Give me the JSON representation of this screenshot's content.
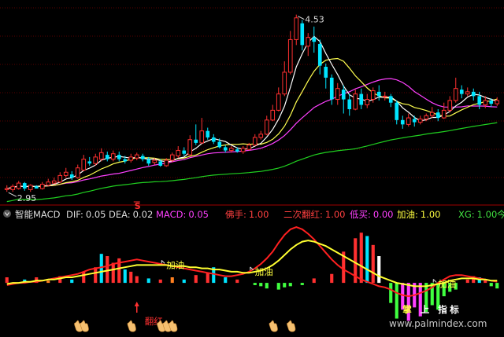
{
  "chart_data": [
    {
      "type": "candlestick",
      "panel": "main",
      "ylim": [
        2.8,
        4.65
      ],
      "annotations": {
        "high_label": "4.53",
        "low_label": "2.95",
        "marker": "S"
      },
      "colors": {
        "up": "#ff3030",
        "down": "#00e5ff",
        "ma_short": "#ffffff",
        "ma_mid": "#ffff50",
        "ma_long": "#ff40ff",
        "ma_longest": "#20d020"
      },
      "candles": [
        [
          2.92,
          2.93,
          2.96,
          2.9
        ],
        [
          2.92,
          2.95,
          2.97,
          2.9
        ],
        [
          2.93,
          2.98,
          3.0,
          2.92
        ],
        [
          2.98,
          2.93,
          2.99,
          2.91
        ],
        [
          2.92,
          2.96,
          2.97,
          2.9
        ],
        [
          2.95,
          2.93,
          2.96,
          2.95
        ],
        [
          2.93,
          2.97,
          2.99,
          2.92
        ],
        [
          2.96,
          2.99,
          3.02,
          2.95
        ],
        [
          2.98,
          3.0,
          3.03,
          2.97
        ],
        [
          2.99,
          3.05,
          3.08,
          2.98
        ],
        [
          3.05,
          3.08,
          3.12,
          3.03
        ],
        [
          3.06,
          3.03,
          3.09,
          3.01
        ],
        [
          3.03,
          3.12,
          3.15,
          3.02
        ],
        [
          3.1,
          3.2,
          3.24,
          3.09
        ],
        [
          3.18,
          3.16,
          3.22,
          3.14
        ],
        [
          3.16,
          3.22,
          3.25,
          3.14
        ],
        [
          3.2,
          3.26,
          3.3,
          3.18
        ],
        [
          3.24,
          3.2,
          3.27,
          3.18
        ],
        [
          3.2,
          3.25,
          3.28,
          3.18
        ],
        [
          3.24,
          3.2,
          3.27,
          3.18
        ],
        [
          3.2,
          3.18,
          3.23,
          3.16
        ],
        [
          3.19,
          3.22,
          3.25,
          3.17
        ],
        [
          3.21,
          3.24,
          3.26,
          3.19
        ],
        [
          3.23,
          3.2,
          3.25,
          3.18
        ],
        [
          3.2,
          3.16,
          3.22,
          3.14
        ],
        [
          3.17,
          3.19,
          3.21,
          3.15
        ],
        [
          3.18,
          3.14,
          3.2,
          3.13
        ],
        [
          3.14,
          3.19,
          3.21,
          3.13
        ],
        [
          3.19,
          3.24,
          3.26,
          3.17
        ],
        [
          3.23,
          3.28,
          3.32,
          3.21
        ],
        [
          3.28,
          3.25,
          3.31,
          3.23
        ],
        [
          3.24,
          3.38,
          3.42,
          3.23
        ],
        [
          3.38,
          3.35,
          3.52,
          3.33
        ],
        [
          3.35,
          3.46,
          3.58,
          3.34
        ],
        [
          3.46,
          3.4,
          3.49,
          3.38
        ],
        [
          3.4,
          3.36,
          3.43,
          3.34
        ],
        [
          3.36,
          3.31,
          3.39,
          3.3
        ],
        [
          3.31,
          3.28,
          3.33,
          3.26
        ],
        [
          3.28,
          3.3,
          3.32,
          3.26
        ],
        [
          3.29,
          3.27,
          3.31,
          3.26
        ],
        [
          3.27,
          3.3,
          3.32,
          3.25
        ],
        [
          3.29,
          3.33,
          3.35,
          3.28
        ],
        [
          3.33,
          3.4,
          3.43,
          3.32
        ],
        [
          3.4,
          3.43,
          3.46,
          3.38
        ],
        [
          3.43,
          3.56,
          3.6,
          3.42
        ],
        [
          3.56,
          3.65,
          3.7,
          3.55
        ],
        [
          3.65,
          3.8,
          3.86,
          3.64
        ],
        [
          3.8,
          4.0,
          4.1,
          3.78
        ],
        [
          4.0,
          4.3,
          4.38,
          3.98
        ],
        [
          4.3,
          4.5,
          4.53,
          4.25
        ],
        [
          4.45,
          4.25,
          4.48,
          4.2
        ],
        [
          4.24,
          4.32,
          4.36,
          4.15
        ],
        [
          4.32,
          4.28,
          4.42,
          4.18
        ],
        [
          4.26,
          4.06,
          4.3,
          3.98
        ],
        [
          4.05,
          3.95,
          4.08,
          3.85
        ],
        [
          3.95,
          3.75,
          3.98,
          3.7
        ],
        [
          3.75,
          3.85,
          3.9,
          3.7
        ],
        [
          3.84,
          3.75,
          3.88,
          3.62
        ],
        [
          3.75,
          3.66,
          3.8,
          3.6
        ],
        [
          3.66,
          3.8,
          3.84,
          3.65
        ],
        [
          3.8,
          3.7,
          3.85,
          3.66
        ],
        [
          3.7,
          3.75,
          3.8,
          3.67
        ],
        [
          3.75,
          3.83,
          3.86,
          3.72
        ],
        [
          3.82,
          3.78,
          3.88,
          3.74
        ],
        [
          3.78,
          3.78,
          3.82,
          3.74
        ],
        [
          3.78,
          3.72,
          3.8,
          3.68
        ],
        [
          3.72,
          3.56,
          3.74,
          3.52
        ],
        [
          3.56,
          3.52,
          3.6,
          3.48
        ],
        [
          3.52,
          3.58,
          3.62,
          3.5
        ],
        [
          3.57,
          3.54,
          3.6,
          3.5
        ],
        [
          3.54,
          3.57,
          3.6,
          3.52
        ],
        [
          3.57,
          3.6,
          3.62,
          3.55
        ],
        [
          3.6,
          3.63,
          3.68,
          3.58
        ],
        [
          3.63,
          3.58,
          3.66,
          3.55
        ],
        [
          3.58,
          3.65,
          3.72,
          3.57
        ],
        [
          3.65,
          3.74,
          3.78,
          3.63
        ],
        [
          3.74,
          3.85,
          3.95,
          3.72
        ],
        [
          3.84,
          3.8,
          3.88,
          3.76
        ],
        [
          3.8,
          3.82,
          3.86,
          3.78
        ],
        [
          3.82,
          3.78,
          3.85,
          3.74
        ],
        [
          3.78,
          3.7,
          3.82,
          3.66
        ],
        [
          3.7,
          3.74,
          3.78,
          3.67
        ],
        [
          3.74,
          3.71,
          3.76,
          3.68
        ],
        [
          3.71,
          3.74,
          3.77,
          3.69
        ]
      ]
    },
    {
      "type": "bar",
      "panel": "indicator",
      "indicator_title": "智能MACD",
      "legend": [
        {
          "label": "DIF:",
          "value": "0.05",
          "color": "#ffffff"
        },
        {
          "label": "DEA:",
          "value": "0.02",
          "color": "#ffff40"
        },
        {
          "label": "MACD:",
          "value": "0.05",
          "color": "#ff40ff"
        },
        {
          "label": "佛手:",
          "value": "1.00",
          "color": "#ff4040"
        },
        {
          "label": "二次翻红:",
          "value": "1.00",
          "color": "#ff4040"
        },
        {
          "label": "低买:",
          "value": "0.00",
          "color": "#ff40ff"
        },
        {
          "label": "加油:",
          "value": "1.00",
          "color": "#ffff40"
        },
        {
          "label": "XG:",
          "value": "1.00",
          "color": "#40e040"
        },
        {
          "label": "今",
          "value": "",
          "color": "#40e040"
        }
      ],
      "ylim": [
        -0.45,
        0.55
      ],
      "zero_line": 0,
      "series_dif": [
        -0.02,
        -0.01,
        0.0,
        0.0,
        0.01,
        0.01,
        0.02,
        0.03,
        0.04,
        0.05,
        0.06,
        0.07,
        0.08,
        0.1,
        0.12,
        0.13,
        0.14,
        0.15,
        0.17,
        0.18,
        0.19,
        0.2,
        0.21,
        0.2,
        0.19,
        0.18,
        0.17,
        0.16,
        0.15,
        0.14,
        0.13,
        0.12,
        0.11,
        0.1,
        0.09,
        0.08,
        0.07,
        0.06,
        0.06,
        0.07,
        0.08,
        0.1,
        0.13,
        0.17,
        0.22,
        0.28,
        0.36,
        0.43,
        0.48,
        0.5,
        0.48,
        0.44,
        0.39,
        0.33,
        0.27,
        0.21,
        0.16,
        0.12,
        0.09,
        0.06,
        0.03,
        0.01,
        -0.01,
        -0.03,
        -0.04,
        -0.06,
        -0.09,
        -0.11,
        -0.12,
        -0.11,
        -0.09,
        -0.07,
        -0.04,
        0.0,
        0.03,
        0.06,
        0.07,
        0.07,
        0.06,
        0.05,
        0.04,
        0.03,
        0.02,
        0.01
      ],
      "series_dea": [
        -0.01,
        0.0,
        0.0,
        0.01,
        0.01,
        0.02,
        0.02,
        0.03,
        0.03,
        0.04,
        0.05,
        0.05,
        0.06,
        0.07,
        0.08,
        0.09,
        0.1,
        0.11,
        0.12,
        0.13,
        0.14,
        0.15,
        0.16,
        0.16,
        0.16,
        0.16,
        0.16,
        0.16,
        0.15,
        0.15,
        0.15,
        0.14,
        0.14,
        0.13,
        0.13,
        0.12,
        0.12,
        0.11,
        0.1,
        0.1,
        0.09,
        0.09,
        0.1,
        0.11,
        0.13,
        0.16,
        0.2,
        0.25,
        0.3,
        0.34,
        0.37,
        0.38,
        0.37,
        0.35,
        0.33,
        0.3,
        0.27,
        0.24,
        0.21,
        0.18,
        0.15,
        0.12,
        0.09,
        0.06,
        0.04,
        0.02,
        0.0,
        -0.01,
        -0.02,
        -0.03,
        -0.03,
        -0.03,
        -0.02,
        -0.01,
        0.0,
        0.02,
        0.03,
        0.04,
        0.04,
        0.04,
        0.03,
        0.03,
        0.02,
        0.02
      ],
      "histogram": [
        {
          "i": 0,
          "v": 0.05,
          "c": "#ff3030"
        },
        {
          "i": 3,
          "v": 0.03,
          "c": "#00e5ff"
        },
        {
          "i": 5,
          "v": 0.05,
          "c": "#ff3030"
        },
        {
          "i": 7,
          "v": 0.02,
          "c": "#ff8020"
        },
        {
          "i": 9,
          "v": 0.06,
          "c": "#ff3030"
        },
        {
          "i": 11,
          "v": 0.03,
          "c": "#00e5ff"
        },
        {
          "i": 13,
          "v": 0.1,
          "c": "#ff3030"
        },
        {
          "i": 15,
          "v": 0.14,
          "c": "#ff3030"
        },
        {
          "i": 16,
          "v": 0.26,
          "c": "#00e5ff"
        },
        {
          "i": 17,
          "v": 0.24,
          "c": "#ff3030"
        },
        {
          "i": 18,
          "v": 0.18,
          "c": "#ff3030"
        },
        {
          "i": 19,
          "v": 0.22,
          "c": "#ff3030"
        },
        {
          "i": 20,
          "v": 0.12,
          "c": "#00e5ff"
        },
        {
          "i": 21,
          "v": 0.1,
          "c": "#ff3030"
        },
        {
          "i": 22,
          "v": 0.06,
          "c": "#ff3030"
        },
        {
          "i": 24,
          "v": 0.04,
          "c": "#00e5ff"
        },
        {
          "i": 26,
          "v": 0.03,
          "c": "#ff3030"
        },
        {
          "i": 28,
          "v": 0.05,
          "c": "#ff8020"
        },
        {
          "i": 30,
          "v": 0.03,
          "c": "#00e5ff"
        },
        {
          "i": 32,
          "v": 0.07,
          "c": "#ff3030"
        },
        {
          "i": 34,
          "v": 0.09,
          "c": "#ff3030"
        },
        {
          "i": 35,
          "v": 0.14,
          "c": "#00e5ff"
        },
        {
          "i": 37,
          "v": 0.05,
          "c": "#00e5ff"
        },
        {
          "i": 39,
          "v": 0.03,
          "c": "#ff3030"
        },
        {
          "i": 42,
          "v": -0.02,
          "c": "#40ff40"
        },
        {
          "i": 43,
          "v": -0.03,
          "c": "#40ff40"
        },
        {
          "i": 44,
          "v": -0.05,
          "c": "#40ff40"
        },
        {
          "i": 46,
          "v": -0.06,
          "c": "#40ff40"
        },
        {
          "i": 47,
          "v": -0.04,
          "c": "#40ff40"
        },
        {
          "i": 48,
          "v": -0.03,
          "c": "#40ff40"
        },
        {
          "i": 50,
          "v": -0.02,
          "c": "#40ff40"
        },
        {
          "i": 52,
          "v": 0.04,
          "c": "#ff3030"
        },
        {
          "i": 55,
          "v": 0.08,
          "c": "#ff3030"
        },
        {
          "i": 57,
          "v": 0.28,
          "c": "#ff3030"
        },
        {
          "i": 59,
          "v": 0.4,
          "c": "#ff3030"
        },
        {
          "i": 60,
          "v": 0.45,
          "c": "#ff3030"
        },
        {
          "i": 61,
          "v": 0.42,
          "c": "#00e5ff"
        },
        {
          "i": 62,
          "v": 0.34,
          "c": "#ff3030"
        },
        {
          "i": 63,
          "v": 0.24,
          "c": "#ffffff"
        },
        {
          "i": 65,
          "v": -0.18,
          "c": "#40ff40"
        },
        {
          "i": 66,
          "v": -0.32,
          "c": "#40ff40"
        },
        {
          "i": 67,
          "v": -0.24,
          "c": "#ff40ff"
        },
        {
          "i": 68,
          "v": -0.34,
          "c": "#ff40ff"
        },
        {
          "i": 69,
          "v": -0.22,
          "c": "#ff40ff"
        },
        {
          "i": 70,
          "v": -0.3,
          "c": "#ff40ff"
        },
        {
          "i": 71,
          "v": -0.26,
          "c": "#40ff40"
        },
        {
          "i": 72,
          "v": -0.2,
          "c": "#40ff40"
        },
        {
          "i": 73,
          "v": -0.24,
          "c": "#40ff40"
        },
        {
          "i": 74,
          "v": -0.12,
          "c": "#40ff40"
        },
        {
          "i": 75,
          "v": -0.08,
          "c": "#40ff40"
        },
        {
          "i": 76,
          "v": -0.06,
          "c": "#40ff40"
        },
        {
          "i": 78,
          "v": 0.03,
          "c": "#ff3030"
        },
        {
          "i": 79,
          "v": 0.06,
          "c": "#ff3030"
        },
        {
          "i": 80,
          "v": 0.05,
          "c": "#00e5ff"
        },
        {
          "i": 81,
          "v": 0.03,
          "c": "#ff3030"
        },
        {
          "i": 82,
          "v": -0.03,
          "c": "#40ff40"
        },
        {
          "i": 83,
          "v": -0.05,
          "c": "#40ff40"
        }
      ],
      "signals": [
        {
          "i": 27,
          "text": "加油",
          "color": "#ffff40"
        },
        {
          "i": 42,
          "text": "加油",
          "color": "#ffff40"
        },
        {
          "i": 73,
          "text": "加油",
          "color": "#ffff40"
        },
        {
          "i": 67,
          "text": "掌",
          "color": "#ffff40"
        },
        {
          "i": 70,
          "text": "上",
          "color": "#ffffff"
        },
        {
          "i": 73,
          "text": "指",
          "color": "#ffffff"
        },
        {
          "i": 75,
          "text": "标",
          "color": "#ffffff"
        }
      ],
      "red_flip": {
        "i": 22,
        "text": "翻红",
        "color": "#ff3030"
      },
      "hands": [
        12,
        13,
        21,
        26,
        27,
        28,
        45,
        48
      ],
      "watermark": "www.palmindex.com"
    }
  ]
}
